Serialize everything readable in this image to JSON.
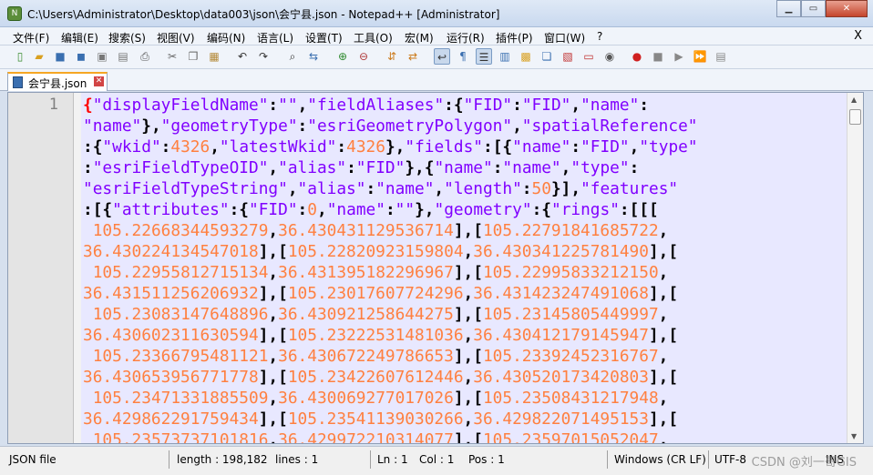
{
  "window": {
    "title": "C:\\Users\\Administrator\\Desktop\\data003\\json\\会宁县.json - Notepad++ [Administrator]",
    "app_icon": "notepadpp-icon",
    "min_label": "▁",
    "max_label": "▭",
    "close_label": "✕"
  },
  "menu": {
    "items": [
      "文件(F)",
      "编辑(E)",
      "搜索(S)",
      "视图(V)",
      "编码(N)",
      "语言(L)",
      "设置(T)",
      "工具(O)",
      "宏(M)",
      "运行(R)",
      "插件(P)",
      "窗口(W)",
      "?"
    ],
    "close_label": "X"
  },
  "toolbar": {
    "icons": [
      "new-file-icon",
      "open-file-icon",
      "save-icon",
      "save-all-icon",
      "close-icon",
      "close-all-icon",
      "print-icon",
      "cut-icon",
      "copy-icon",
      "paste-icon",
      "undo-icon",
      "redo-icon",
      "find-icon",
      "replace-icon",
      "zoom-in-icon",
      "zoom-out-icon",
      "sync-v-icon",
      "sync-h-icon",
      "word-wrap-icon",
      "show-all-chars-icon",
      "indent-guide-icon",
      "lang-doc-icon",
      "doc-map-icon",
      "function-list-icon",
      "folder-workspace-icon",
      "monitor-icon",
      "record-macro-icon",
      "stop-macro-icon",
      "play-macro-icon",
      "run-macro-multi-icon",
      "save-macro-icon"
    ]
  },
  "tab": {
    "label": "会宁县.json",
    "close_label": "✕"
  },
  "editor": {
    "line_number": "1",
    "lines": [
      [
        [
          "b",
          "{"
        ],
        [
          "k",
          "\"displayFieldName\""
        ],
        [
          "p",
          ":"
        ],
        [
          "k",
          "\"\""
        ],
        [
          "p",
          ","
        ],
        [
          "k",
          "\"fieldAliases\""
        ],
        [
          "p",
          ":{"
        ],
        [
          "k",
          "\"FID\""
        ],
        [
          "p",
          ":"
        ],
        [
          "k",
          "\"FID\""
        ],
        [
          "p",
          ","
        ],
        [
          "k",
          "\"name\""
        ],
        [
          "p",
          ":"
        ]
      ],
      [
        [
          "k",
          "\"name\""
        ],
        [
          "p",
          "},"
        ],
        [
          "k",
          "\"geometryType\""
        ],
        [
          "p",
          ":"
        ],
        [
          "k",
          "\"esriGeometryPolygon\""
        ],
        [
          "p",
          ","
        ],
        [
          "k",
          "\"spatialReference\""
        ]
      ],
      [
        [
          "p",
          ":{"
        ],
        [
          "k",
          "\"wkid\""
        ],
        [
          "p",
          ":"
        ],
        [
          "n",
          "4326"
        ],
        [
          "p",
          ","
        ],
        [
          "k",
          "\"latestWkid\""
        ],
        [
          "p",
          ":"
        ],
        [
          "n",
          "4326"
        ],
        [
          "p",
          "},"
        ],
        [
          "k",
          "\"fields\""
        ],
        [
          "p",
          ":[{"
        ],
        [
          "k",
          "\"name\""
        ],
        [
          "p",
          ":"
        ],
        [
          "k",
          "\"FID\""
        ],
        [
          "p",
          ","
        ],
        [
          "k",
          "\"type\""
        ]
      ],
      [
        [
          "p",
          ":"
        ],
        [
          "k",
          "\"esriFieldTypeOID\""
        ],
        [
          "p",
          ","
        ],
        [
          "k",
          "\"alias\""
        ],
        [
          "p",
          ":"
        ],
        [
          "k",
          "\"FID\""
        ],
        [
          "p",
          "},{"
        ],
        [
          "k",
          "\"name\""
        ],
        [
          "p",
          ":"
        ],
        [
          "k",
          "\"name\""
        ],
        [
          "p",
          ","
        ],
        [
          "k",
          "\"type\""
        ],
        [
          "p",
          ":"
        ]
      ],
      [
        [
          "k",
          "\"esriFieldTypeString\""
        ],
        [
          "p",
          ","
        ],
        [
          "k",
          "\"alias\""
        ],
        [
          "p",
          ":"
        ],
        [
          "k",
          "\"name\""
        ],
        [
          "p",
          ","
        ],
        [
          "k",
          "\"length\""
        ],
        [
          "p",
          ":"
        ],
        [
          "n",
          "50"
        ],
        [
          "p",
          "}],"
        ],
        [
          "k",
          "\"features\""
        ]
      ],
      [
        [
          "p",
          ":[{"
        ],
        [
          "k",
          "\"attributes\""
        ],
        [
          "p",
          ":{"
        ],
        [
          "k",
          "\"FID\""
        ],
        [
          "p",
          ":"
        ],
        [
          "n",
          "0"
        ],
        [
          "p",
          ","
        ],
        [
          "k",
          "\"name\""
        ],
        [
          "p",
          ":"
        ],
        [
          "k",
          "\"\""
        ],
        [
          "p",
          "},"
        ],
        [
          "k",
          "\"geometry\""
        ],
        [
          "p",
          ":{"
        ],
        [
          "k",
          "\"rings\""
        ],
        [
          "p",
          ":[[["
        ]
      ],
      [
        [
          "s",
          " "
        ],
        [
          "n",
          "105.22668344593279"
        ],
        [
          "p",
          ","
        ],
        [
          "n",
          "36.430431129536714"
        ],
        [
          "p",
          "],["
        ],
        [
          "n",
          "105.22791841685722"
        ],
        [
          "p",
          ","
        ]
      ],
      [
        [
          "n",
          "36.430224134547018"
        ],
        [
          "p",
          "],["
        ],
        [
          "n",
          "105.22820923159804"
        ],
        [
          "p",
          ","
        ],
        [
          "n",
          "36.430341225781490"
        ],
        [
          "p",
          "],["
        ]
      ],
      [
        [
          "s",
          " "
        ],
        [
          "n",
          "105.22955812715134"
        ],
        [
          "p",
          ","
        ],
        [
          "n",
          "36.431395182296967"
        ],
        [
          "p",
          "],["
        ],
        [
          "n",
          "105.22995833212150"
        ],
        [
          "p",
          ","
        ]
      ],
      [
        [
          "n",
          "36.431511256206932"
        ],
        [
          "p",
          "],["
        ],
        [
          "n",
          "105.23017607724296"
        ],
        [
          "p",
          ","
        ],
        [
          "n",
          "36.431423247491068"
        ],
        [
          "p",
          "],["
        ]
      ],
      [
        [
          "s",
          " "
        ],
        [
          "n",
          "105.23083147648896"
        ],
        [
          "p",
          ","
        ],
        [
          "n",
          "36.430921258644275"
        ],
        [
          "p",
          "],["
        ],
        [
          "n",
          "105.23145805449997"
        ],
        [
          "p",
          ","
        ]
      ],
      [
        [
          "n",
          "36.430602311630594"
        ],
        [
          "p",
          "],["
        ],
        [
          "n",
          "105.23222531481036"
        ],
        [
          "p",
          ","
        ],
        [
          "n",
          "36.430412179145947"
        ],
        [
          "p",
          "],["
        ]
      ],
      [
        [
          "s",
          " "
        ],
        [
          "n",
          "105.23366795481121"
        ],
        [
          "p",
          ","
        ],
        [
          "n",
          "36.430672249786653"
        ],
        [
          "p",
          "],["
        ],
        [
          "n",
          "105.23392452316767"
        ],
        [
          "p",
          ","
        ]
      ],
      [
        [
          "n",
          "36.430653956771778"
        ],
        [
          "p",
          "],["
        ],
        [
          "n",
          "105.23422607612446"
        ],
        [
          "p",
          ","
        ],
        [
          "n",
          "36.430520173420803"
        ],
        [
          "p",
          "],["
        ]
      ],
      [
        [
          "s",
          " "
        ],
        [
          "n",
          "105.23471331885509"
        ],
        [
          "p",
          ","
        ],
        [
          "n",
          "36.430069277017026"
        ],
        [
          "p",
          "],["
        ],
        [
          "n",
          "105.23508431217948"
        ],
        [
          "p",
          ","
        ]
      ],
      [
        [
          "n",
          "36.429862291759434"
        ],
        [
          "p",
          "],["
        ],
        [
          "n",
          "105.23541139030266"
        ],
        [
          "p",
          ","
        ],
        [
          "n",
          "36.429822071495153"
        ],
        [
          "p",
          "],["
        ]
      ],
      [
        [
          "s",
          " "
        ],
        [
          "n",
          "105.23573737101816"
        ],
        [
          "p",
          ","
        ],
        [
          "n",
          "36.429972210314077"
        ],
        [
          "p",
          "],["
        ],
        [
          "n",
          "105.23597015052047"
        ],
        [
          "p",
          ","
        ]
      ]
    ]
  },
  "statusbar": {
    "file_type": "JSON file",
    "length": "length : 198,182",
    "lines": "lines : 1",
    "ln": "Ln : 1",
    "col": "Col : 1",
    "pos": "Pos : 1",
    "eol": "Windows (CR LF)",
    "encoding": "UTF-8",
    "mode": "INS",
    "watermark": "CSDN @刘一哥GIS"
  }
}
